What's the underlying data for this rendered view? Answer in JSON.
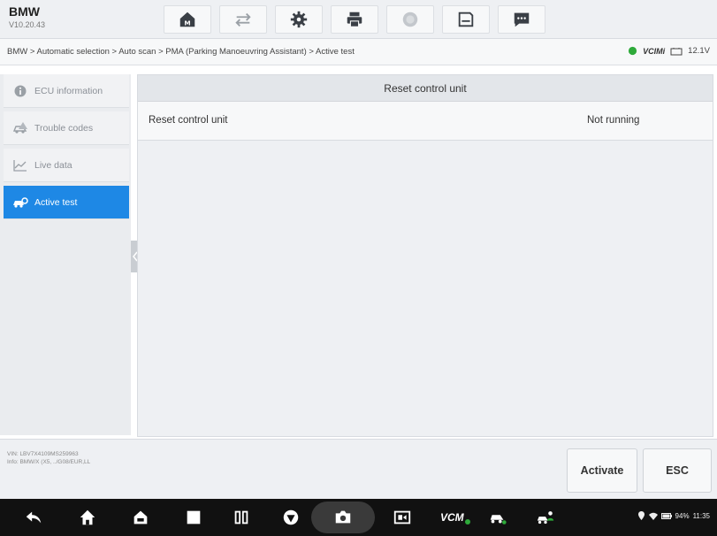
{
  "app": {
    "brand": "BMW",
    "version": "V10.20.43"
  },
  "toolbar": {
    "icons": [
      "home-icon",
      "vehicle-swap-icon",
      "settings-gear-icon",
      "print-icon",
      "help-icon",
      "save-icon",
      "message-icon"
    ]
  },
  "breadcrumb": "BMW > Automatic selection > Auto scan > PMA (Parking Manoeuvring Assistant) > Active test",
  "status": {
    "vci": "VCIMi",
    "voltage": "12.1V"
  },
  "sidebar": {
    "items": [
      {
        "label": "ECU information",
        "icon": "info-icon"
      },
      {
        "label": "Trouble codes",
        "icon": "car-fault-icon"
      },
      {
        "label": "Live data",
        "icon": "chart-icon"
      },
      {
        "label": "Active test",
        "icon": "car-gear-icon",
        "active": true
      }
    ]
  },
  "main": {
    "title": "Reset control unit",
    "rows": [
      {
        "name": "Reset control unit",
        "status": "Not running"
      }
    ]
  },
  "footer": {
    "vin_line": "VIN: LBV7X4109MS259963",
    "info_line": "Info: BMW/X (X5, ../G08/EUR,LL",
    "buttons": {
      "activate": "Activate",
      "esc": "ESC"
    }
  },
  "navbar": {
    "vcm": "VCM",
    "system_status": "94%",
    "time": "11:35"
  },
  "colors": {
    "accent": "#1e88e5",
    "navbar": "#111111",
    "status_green": "#2eaa3a"
  }
}
